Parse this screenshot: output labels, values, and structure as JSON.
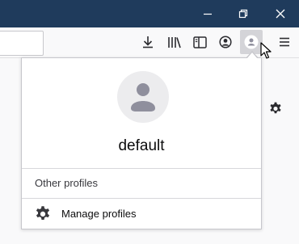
{
  "window": {
    "minimize_icon": "minimize-icon",
    "restore_icon": "restore-icon",
    "close_icon": "close-icon",
    "titlebar_color": "#1f3b5c"
  },
  "toolbar": {
    "url_value": "",
    "icons": [
      "download-icon",
      "library-icon",
      "sidebar-icon",
      "account-icon",
      "profile-icon",
      "menu-icon"
    ]
  },
  "profile_popup": {
    "avatar_icon": "user-avatar-icon",
    "profile_name": "default",
    "other_profiles_label": "Other profiles",
    "manage_profiles_label": "Manage profiles",
    "manage_icon": "gear-icon"
  },
  "page": {
    "settings_icon": "gear-icon"
  }
}
